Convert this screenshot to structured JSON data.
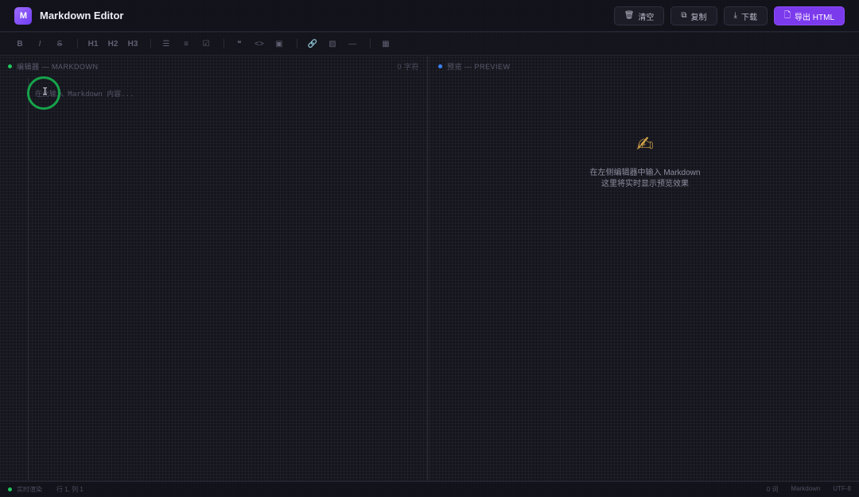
{
  "header": {
    "logo_text": "M",
    "title": "Markdown Editor",
    "actions": [
      {
        "icon": "trash-icon",
        "glyph": "🗑",
        "label": "清空"
      },
      {
        "icon": "copy-icon",
        "glyph": "⧉",
        "label": "复制"
      },
      {
        "icon": "download-icon",
        "glyph": "⤓",
        "label": "下载"
      },
      {
        "icon": "file-icon",
        "glyph": "🗋",
        "label": "导出 HTML"
      }
    ]
  },
  "toolbar": {
    "bold": "B",
    "italic": "I",
    "strike": "S",
    "h1": "H1",
    "h2": "H2",
    "h3": "H3",
    "ul": "☰",
    "ol": "≡",
    "task": "☑",
    "quote": "❝",
    "code": "<>",
    "codeblock": "▣",
    "link": "🔗",
    "image": "▨",
    "hr": "—",
    "table": "▦"
  },
  "editor": {
    "title": "编辑器 — MARKDOWN",
    "meta": "0 字符",
    "placeholder": "在此输入 Markdown 内容..."
  },
  "preview": {
    "title": "预览 — PREVIEW",
    "empty_icon": "✍",
    "empty_line1": "在左侧编辑器中输入 Markdown",
    "empty_line2": "这里将实时显示预览效果"
  },
  "status": {
    "state": "实时渲染",
    "position": "行 1, 列 1",
    "words": "0 词",
    "format": "Markdown",
    "encoding": "UTF-8"
  },
  "colors": {
    "accent": "#7c3aed",
    "ok": "#22c55e",
    "info": "#3b82f6"
  }
}
